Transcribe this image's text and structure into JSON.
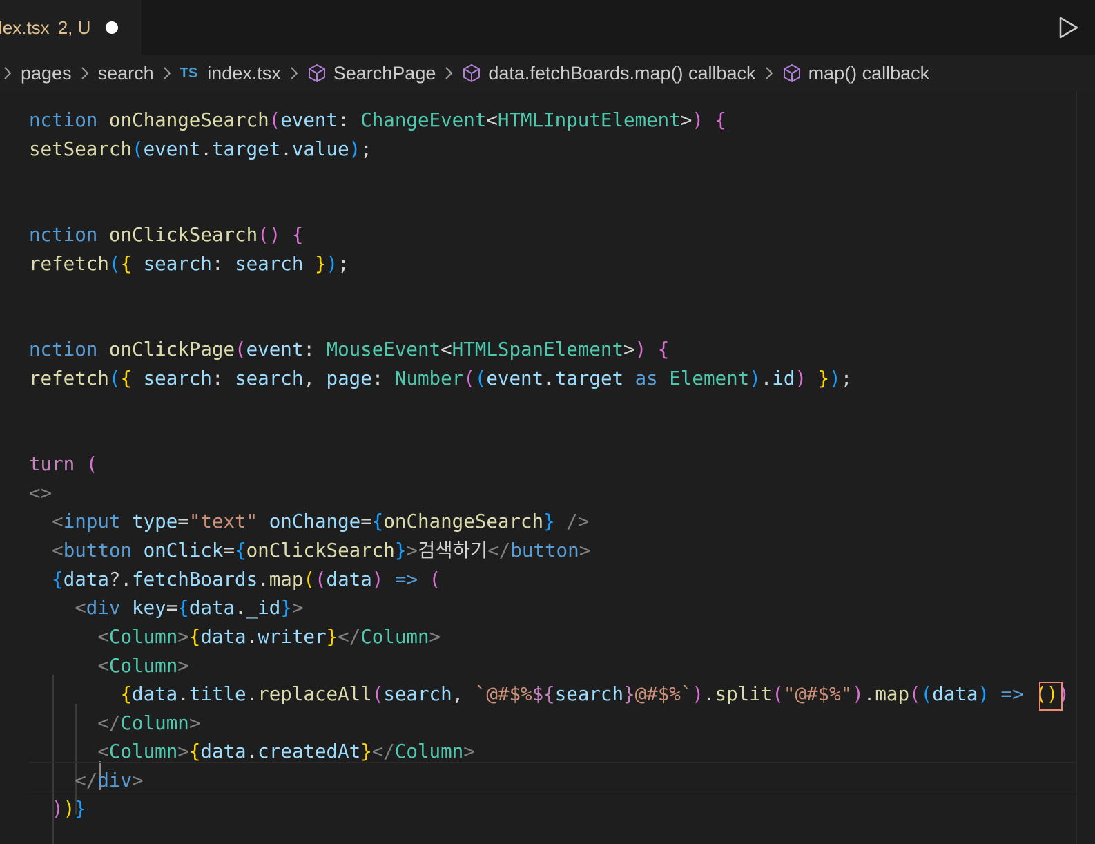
{
  "tab": {
    "name": "lex.tsx",
    "status": "2, U"
  },
  "breadcrumb": {
    "items": [
      "pages",
      "search",
      "index.tsx",
      "SearchPage",
      "data.fetchBoards.map() callback",
      "map() callback"
    ],
    "ts_label": "TS"
  },
  "code": {
    "l1a": "nction",
    "l1b": "onChangeSearch",
    "l1c": "event",
    "l1d": "ChangeEvent",
    "l1e": "HTMLInputElement",
    "l2a": "setSearch",
    "l2b": "event",
    "l2c": "target",
    "l2d": "value",
    "l3a": "nction",
    "l3b": "onClickSearch",
    "l4a": "refetch",
    "l4b": "search",
    "l4c": "search",
    "l5a": "nction",
    "l5b": "onClickPage",
    "l5c": "event",
    "l5d": "MouseEvent",
    "l5e": "HTMLSpanElement",
    "l6a": "refetch",
    "l6b": "search",
    "l6c": "search",
    "l6d": "page",
    "l6e": "Number",
    "l6f": "event",
    "l6g": "target",
    "l6h": "as",
    "l6i": "Element",
    "l6j": "id",
    "l7a": "turn",
    "l9a": "input",
    "l9b": "type",
    "l9c": "\"text\"",
    "l9d": "onChange",
    "l9e": "onChangeSearch",
    "l10a": "button",
    "l10b": "onClick",
    "l10c": "onClickSearch",
    "l10d": "검색하기",
    "l10e": "button",
    "l11a": "data",
    "l11b": "fetchBoards",
    "l11c": "map",
    "l11d": "data",
    "l12a": "div",
    "l12b": "key",
    "l12c": "data",
    "l12d": "_id",
    "l13a": "Column",
    "l13b": "data",
    "l13c": "writer",
    "l13d": "Column",
    "l14a": "Column",
    "l15a": "data",
    "l15b": "title",
    "l15c": "replaceAll",
    "l15d": "search",
    "l15e": "`@#$%",
    "l15f": "search",
    "l15g": "@#$%`",
    "l15h": "split",
    "l15i": "\"@#$%\"",
    "l15j": "map",
    "l15k": "data",
    "l16a": "Column",
    "l17a": "Column",
    "l17b": "data",
    "l17c": "createdAt",
    "l17d": "Column",
    "l18a": "div"
  }
}
